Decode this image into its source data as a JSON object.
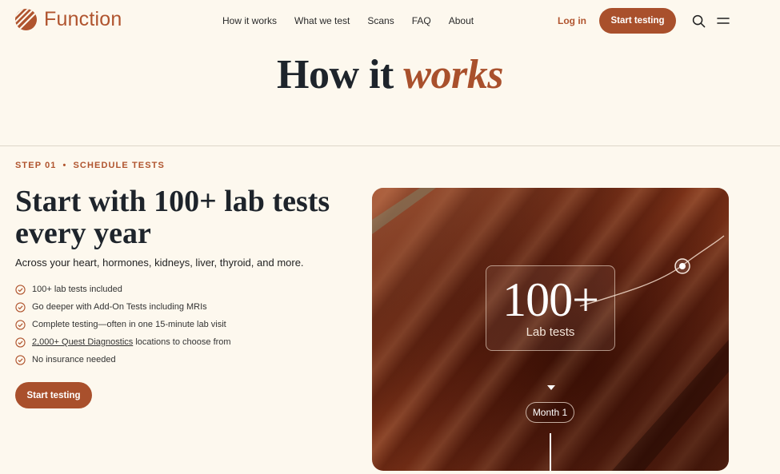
{
  "header": {
    "logo_text": "Function",
    "nav": [
      "How it works",
      "What we test",
      "Scans",
      "FAQ",
      "About"
    ],
    "login_label": "Log in",
    "start_label": "Start testing"
  },
  "hero": {
    "title_main": "How it ",
    "title_accent": "works"
  },
  "step": {
    "number": "STEP 01",
    "name": "SCHEDULE TESTS",
    "title": "Start with 100+ lab tests every year",
    "subtitle": "Across your heart, hormones, kidneys, liver, thyroid, and more.",
    "features": [
      {
        "text": "100+ lab tests included"
      },
      {
        "text": "Go deeper with Add-On Tests including MRIs"
      },
      {
        "text": "Complete testing—often in one 15-minute lab visit"
      },
      {
        "link": "2,000+ Quest Diagnostics",
        "text": " locations to choose from"
      },
      {
        "text": "No insurance needed"
      }
    ],
    "cta_label": "Start testing"
  },
  "card": {
    "stat_value": "100+",
    "stat_label": "Lab tests",
    "month_label": "Month 1"
  },
  "colors": {
    "accent": "#a9502c",
    "background": "#fdf8ee"
  }
}
